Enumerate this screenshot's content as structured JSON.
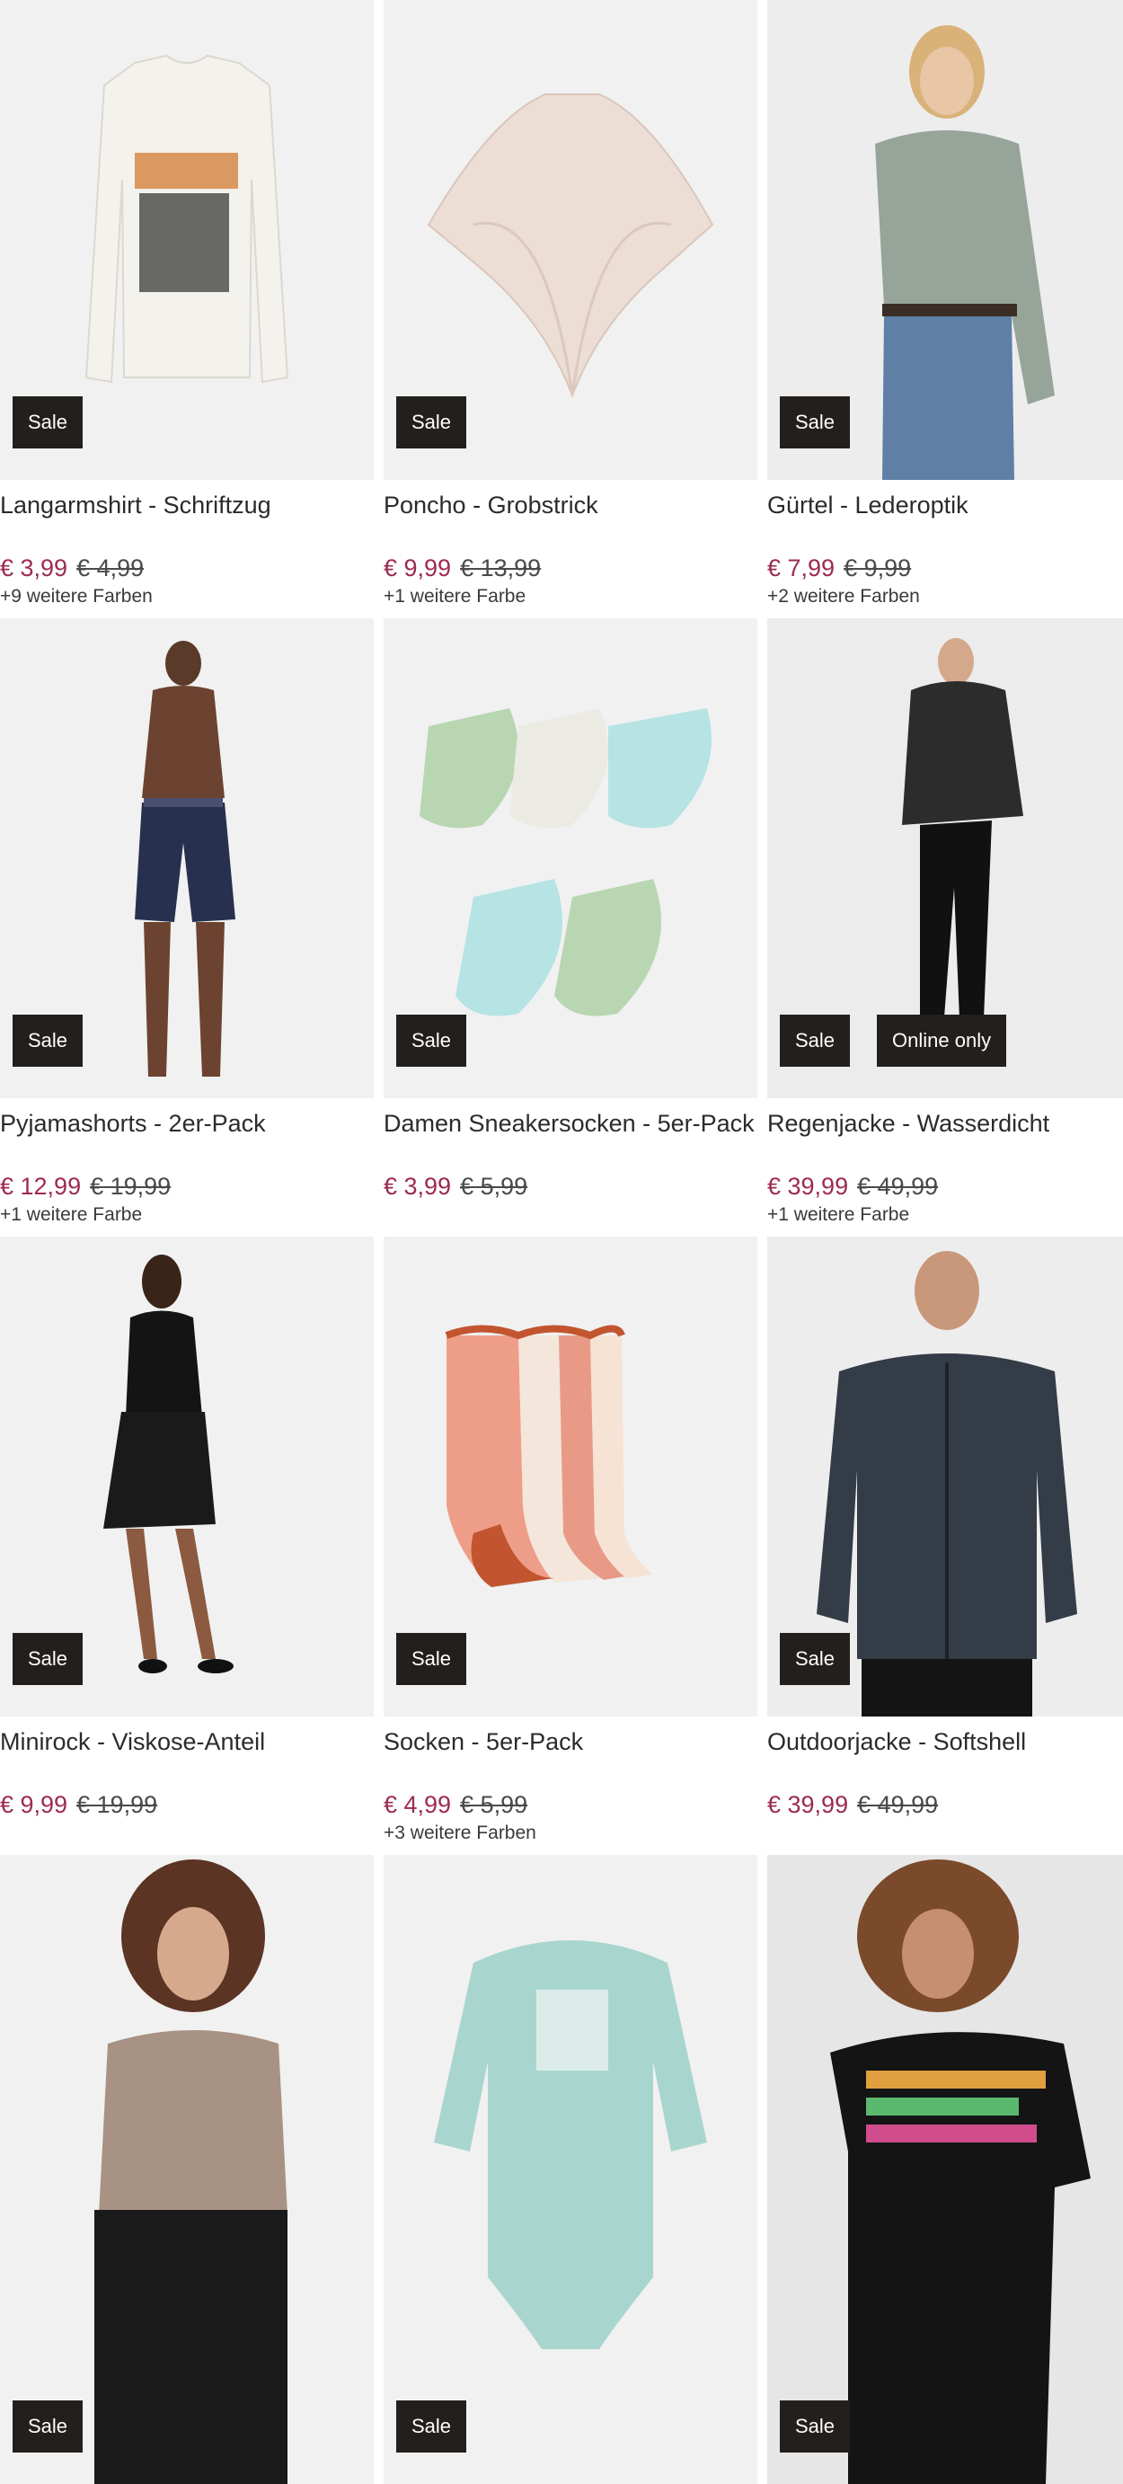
{
  "products": [
    {
      "name": "Langarmshirt - Schriftzug",
      "price": "€ 3,99",
      "old_price": "€ 4,99",
      "colors": "+9 weitere Farben",
      "badges": [
        "Sale"
      ],
      "image_icon": "longsleeve-shirt-icon"
    },
    {
      "name": "Poncho - Grobstrick",
      "price": "€ 9,99",
      "old_price": "€ 13,99",
      "colors": "+1 weitere Farbe",
      "badges": [
        "Sale"
      ],
      "image_icon": "poncho-icon"
    },
    {
      "name": "Gürtel - Lederoptik",
      "price": "€ 7,99",
      "old_price": "€ 9,99",
      "colors": "+2 weitere Farben",
      "badges": [
        "Sale"
      ],
      "image_icon": "belt-model-icon"
    },
    {
      "name": "Pyjamashorts - 2er-Pack",
      "price": "€ 12,99",
      "old_price": "€ 19,99",
      "colors": "+1 weitere Farbe",
      "badges": [
        "Sale"
      ],
      "image_icon": "shorts-model-icon"
    },
    {
      "name": "Damen Sneakersocken - 5er-Pack",
      "price": "€ 3,99",
      "old_price": "€ 5,99",
      "colors": "",
      "badges": [
        "Sale"
      ],
      "image_icon": "sneaker-socks-icon"
    },
    {
      "name": "Regenjacke - Wasserdicht",
      "price": "€ 39,99",
      "old_price": "€ 49,99",
      "colors": "+1 weitere Farbe",
      "badges": [
        "Sale",
        "Online only"
      ],
      "image_icon": "rain-jacket-icon"
    },
    {
      "name": "Minirock - Viskose-Anteil",
      "price": "€ 9,99",
      "old_price": "€ 19,99",
      "colors": "",
      "badges": [
        "Sale"
      ],
      "image_icon": "mini-skirt-model-icon"
    },
    {
      "name": "Socken - 5er-Pack",
      "price": "€ 4,99",
      "old_price": "€ 5,99",
      "colors": "+3 weitere Farben",
      "badges": [
        "Sale"
      ],
      "image_icon": "socks-icon"
    },
    {
      "name": "Outdoorjacke - Softshell",
      "price": "€ 39,99",
      "old_price": "€ 49,99",
      "colors": "",
      "badges": [
        "Sale"
      ],
      "image_icon": "softshell-jacket-icon"
    },
    {
      "name": "",
      "price": "",
      "old_price": "",
      "colors": "",
      "badges": [
        "Sale"
      ],
      "image_icon": "longsleeve-top-model-icon"
    },
    {
      "name": "",
      "price": "",
      "old_price": "",
      "colors": "",
      "badges": [
        "Sale"
      ],
      "image_icon": "baby-bodysuit-icon"
    },
    {
      "name": "",
      "price": "",
      "old_price": "",
      "colors": "",
      "badges": [
        "Sale"
      ],
      "image_icon": "tshirt-model-icon"
    }
  ],
  "colors": {
    "price": "#9c2b50",
    "badge_bg": "#231f1c",
    "image_bg": "#f1f1f1"
  }
}
